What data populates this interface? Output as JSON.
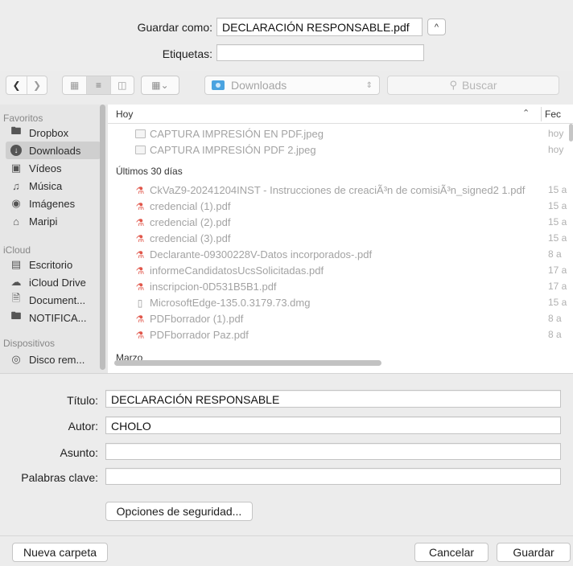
{
  "header": {
    "save_as_label": "Guardar como:",
    "save_as_value": "DECLARACIÓN RESPONSABLE.pdf",
    "tags_label": "Etiquetas:",
    "tags_value": ""
  },
  "toolbar": {
    "location": "Downloads",
    "search_placeholder": "Buscar"
  },
  "sidebar": {
    "favorites_header": "Favoritos",
    "favorites": [
      {
        "label": "Dropbox",
        "icon": "folder-icon"
      },
      {
        "label": "Downloads",
        "icon": "downloads-icon"
      },
      {
        "label": "Vídeos",
        "icon": "film-icon"
      },
      {
        "label": "Música",
        "icon": "music-icon"
      },
      {
        "label": "Imágenes",
        "icon": "camera-icon"
      },
      {
        "label": "Maripi",
        "icon": "home-icon"
      }
    ],
    "icloud_header": "iCloud",
    "icloud": [
      {
        "label": "Escritorio",
        "icon": "desktop-icon"
      },
      {
        "label": "iCloud Drive",
        "icon": "cloud-icon"
      },
      {
        "label": "Document...",
        "icon": "document-icon"
      },
      {
        "label": "NOTIFICA...",
        "icon": "folder-icon"
      }
    ],
    "devices_header": "Dispositivos",
    "devices": [
      {
        "label": "Disco rem...",
        "icon": "disk-icon"
      }
    ]
  },
  "file_list": {
    "column_name": "Hoy",
    "column_date": "Fec",
    "groups": {
      "today": "Hoy",
      "last30": "Últimos 30 días",
      "march": "Marzo"
    },
    "today_files": [
      {
        "name": "CAPTURA IMPRESIÓN EN PDF.jpeg",
        "date": "hoy",
        "type": "image"
      },
      {
        "name": "CAPTURA IMPRESIÓN PDF 2.jpeg",
        "date": "hoy",
        "type": "image"
      }
    ],
    "last30_files": [
      {
        "name": "CkVaZ9-20241204INST - Instrucciones de creaciÃ³n de comisiÃ³n_signed2 1.pdf",
        "date": "15 a",
        "type": "pdf"
      },
      {
        "name": "credencial (1).pdf",
        "date": "15 a",
        "type": "pdf"
      },
      {
        "name": "credencial (2).pdf",
        "date": "15 a",
        "type": "pdf"
      },
      {
        "name": "credencial (3).pdf",
        "date": "15 a",
        "type": "pdf"
      },
      {
        "name": "Declarante-09300228V-Datos incorporados-.pdf",
        "date": "8 a",
        "type": "pdf"
      },
      {
        "name": "informeCandidatosUcsSolicitadas.pdf",
        "date": "17 a",
        "type": "pdf"
      },
      {
        "name": "inscripcion-0D531B5B1.pdf",
        "date": "17 a",
        "type": "pdf"
      },
      {
        "name": "MicrosoftEdge-135.0.3179.73.dmg",
        "date": "15 a",
        "type": "dmg"
      },
      {
        "name": "PDFborrador (1).pdf",
        "date": "8 a",
        "type": "pdf"
      },
      {
        "name": "PDFborrador Paz.pdf",
        "date": "8 a",
        "type": "pdf"
      }
    ]
  },
  "metadata": {
    "title_label": "Título:",
    "title_value": "DECLARACIÓN RESPONSABLE",
    "author_label": "Autor:",
    "author_value": "CHOLO",
    "subject_label": "Asunto:",
    "subject_value": "",
    "keywords_label": "Palabras clave:",
    "keywords_value": "",
    "security_button": "Opciones de seguridad..."
  },
  "footer": {
    "new_folder": "Nueva carpeta",
    "cancel": "Cancelar",
    "save": "Guardar"
  }
}
